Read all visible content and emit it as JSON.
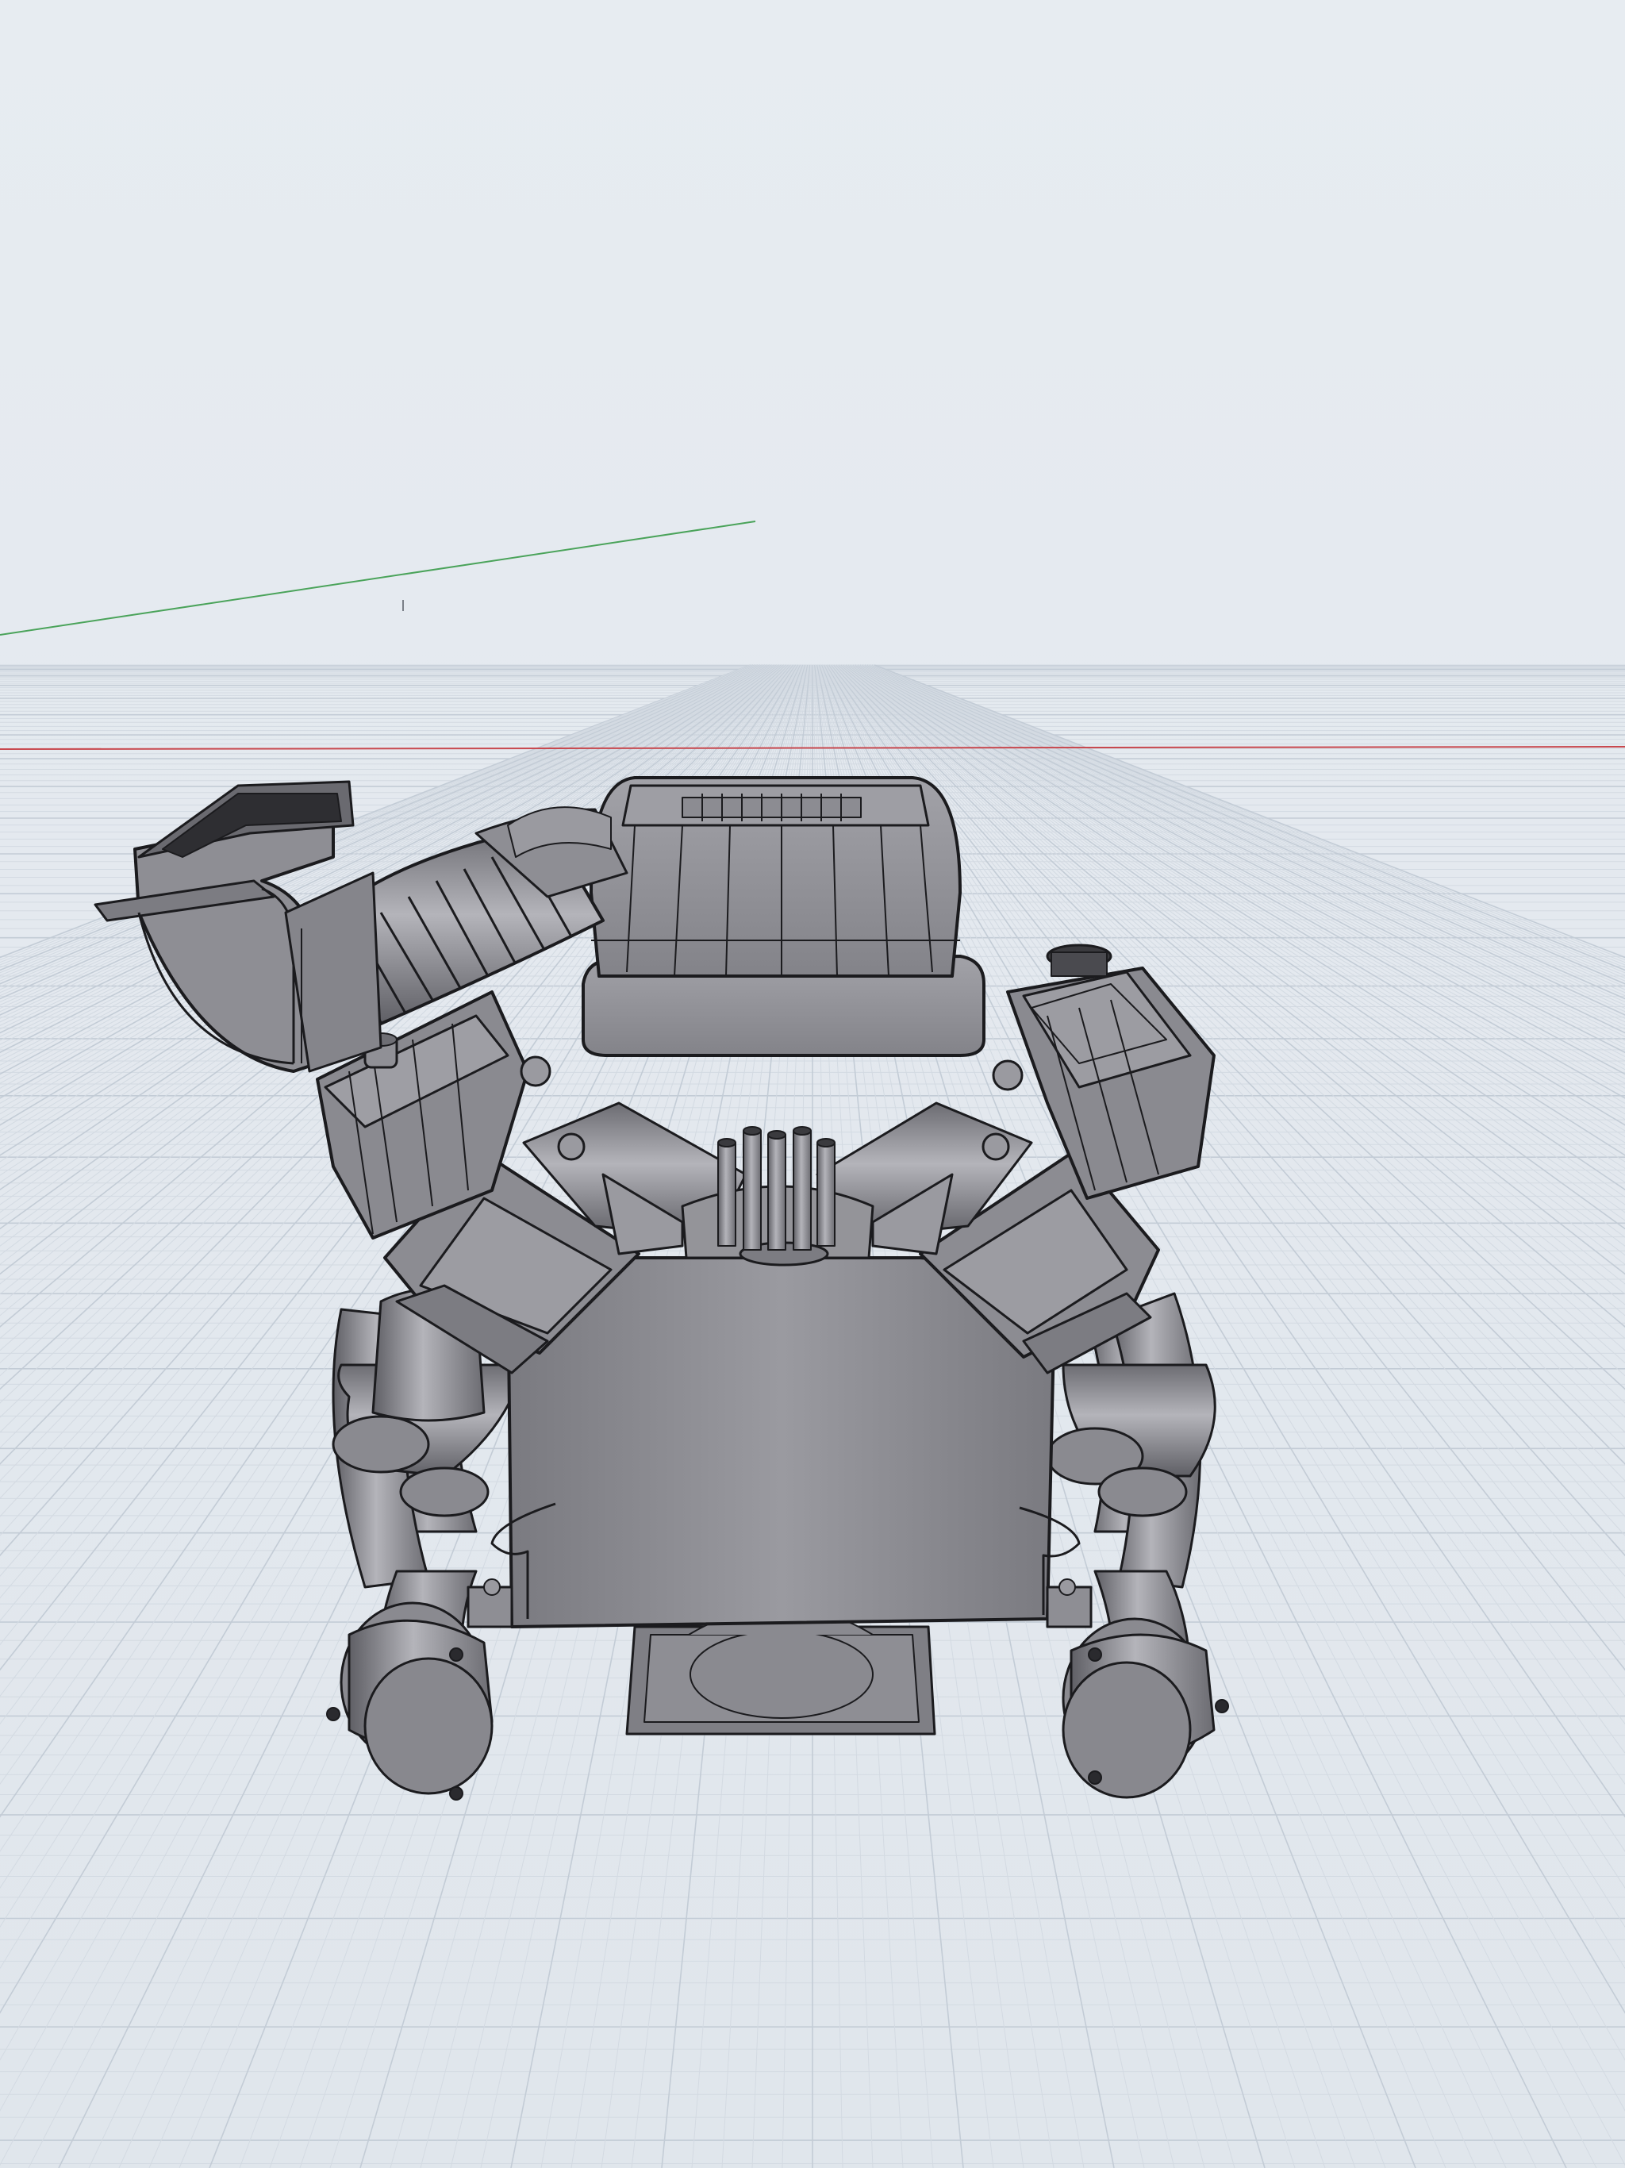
{
  "app": {
    "view": "perspective-3d-viewport",
    "mode": "shaded-with-edges"
  },
  "scene": {
    "grid": {
      "visible": true,
      "minor_color": "#d3dae2",
      "major_color": "#c3ccd6"
    },
    "axes": {
      "x_axis_color": "#c8484e",
      "y_axis_color": "#4aa35a",
      "z_marker_color": "#7a7f87"
    },
    "model": {
      "name": "engine-model",
      "body_color": "#8c8c92",
      "body_light": "#a6a6ac",
      "body_dark": "#6f6f75",
      "edge_color": "#1b1b1e"
    }
  }
}
